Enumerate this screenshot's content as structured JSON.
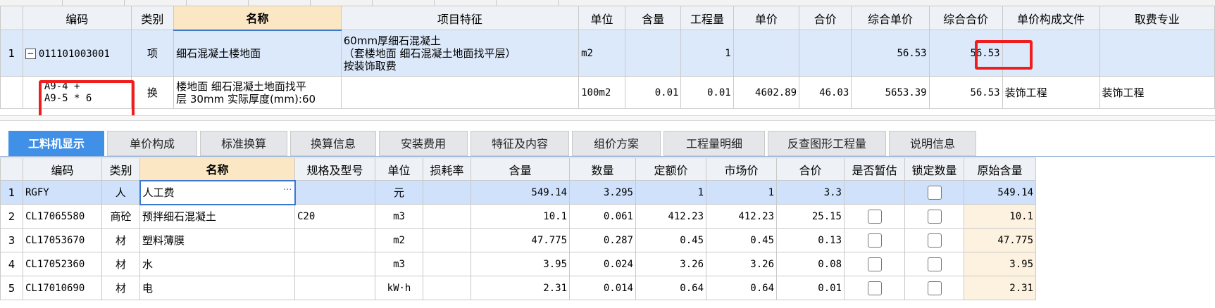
{
  "top_table": {
    "headers": [
      "编码",
      "类别",
      "名称",
      "项目特征",
      "单位",
      "含量",
      "工程量",
      "单价",
      "合价",
      "综合单价",
      "综合合价",
      "单价构成文件",
      "取费专业"
    ],
    "rows": [
      {
        "index": "1",
        "code": "011101003001",
        "type": "项",
        "name": "细石混凝土楼地面",
        "features": [
          "60mm厚细石混凝土",
          "（套楼地面 细石混凝土地面找平层）",
          "按装饰取费"
        ],
        "unit": "m2",
        "content": "",
        "quantity": "1",
        "unit_price": "",
        "total_price": "",
        "comp_unit_price": "56.53",
        "comp_total_price": "56.53",
        "price_file": "",
        "fee_specialty": ""
      },
      {
        "index": "",
        "code_lines": [
          "A9-4 +",
          "A9-5 * 6"
        ],
        "type": "换",
        "name_lines": [
          "楼地面 细石混凝土地面找平",
          "层 30mm  实际厚度(mm):60"
        ],
        "features": "",
        "unit": "100m2",
        "content": "0.01",
        "quantity": "0.01",
        "unit_price": "4602.89",
        "total_price": "46.03",
        "comp_unit_price": "5653.39",
        "comp_total_price": "56.53",
        "price_file": "装饰工程",
        "fee_specialty": "装饰工程"
      }
    ]
  },
  "tabs": [
    {
      "label": "工料机显示",
      "active": true
    },
    {
      "label": "单价构成"
    },
    {
      "label": "标准换算"
    },
    {
      "label": "换算信息"
    },
    {
      "label": "安装费用"
    },
    {
      "label": "特征及内容"
    },
    {
      "label": "组价方案"
    },
    {
      "label": "工程量明细"
    },
    {
      "label": "反查图形工程量"
    },
    {
      "label": "说明信息"
    }
  ],
  "bottom_table": {
    "headers": [
      "编码",
      "类别",
      "名称",
      "规格及型号",
      "单位",
      "损耗率",
      "含量",
      "数量",
      "定额价",
      "市场价",
      "合价",
      "是否暂估",
      "锁定数量",
      "原始含量"
    ],
    "rows": [
      {
        "index": "1",
        "code": "RGFY",
        "type": "人",
        "name": "人工费",
        "spec": "",
        "unit": "元",
        "loss": "",
        "content": "549.14",
        "qty": "3.295",
        "quota": "1",
        "market": "1",
        "total": "3.3",
        "estimate": false,
        "locked": false,
        "original": "549.14"
      },
      {
        "index": "2",
        "code": "CL17065580",
        "type": "商砼",
        "name": "预拌细石混凝土",
        "spec": "C20",
        "unit": "m3",
        "loss": "",
        "content": "10.1",
        "qty": "0.061",
        "quota": "412.23",
        "market": "412.23",
        "total": "25.15",
        "estimate": false,
        "locked": false,
        "original": "10.1"
      },
      {
        "index": "3",
        "code": "CL17053670",
        "type": "材",
        "name": "塑料薄膜",
        "spec": "",
        "unit": "m2",
        "loss": "",
        "content": "47.775",
        "qty": "0.287",
        "quota": "0.45",
        "market": "0.45",
        "total": "0.13",
        "estimate": false,
        "locked": false,
        "original": "47.775"
      },
      {
        "index": "4",
        "code": "CL17052360",
        "type": "材",
        "name": "水",
        "spec": "",
        "unit": "m3",
        "loss": "",
        "content": "3.95",
        "qty": "0.024",
        "quota": "3.26",
        "market": "3.26",
        "total": "0.08",
        "estimate": false,
        "locked": false,
        "original": "3.95"
      },
      {
        "index": "5",
        "code": "CL17010690",
        "type": "材",
        "name": "电",
        "spec": "",
        "unit": "kW·h",
        "loss": "",
        "content": "2.31",
        "qty": "0.014",
        "quota": "0.64",
        "market": "0.64",
        "total": "0.01",
        "estimate": false,
        "locked": false,
        "original": "2.31"
      }
    ]
  },
  "ellipsis": "···",
  "collapse_glyph": "−"
}
